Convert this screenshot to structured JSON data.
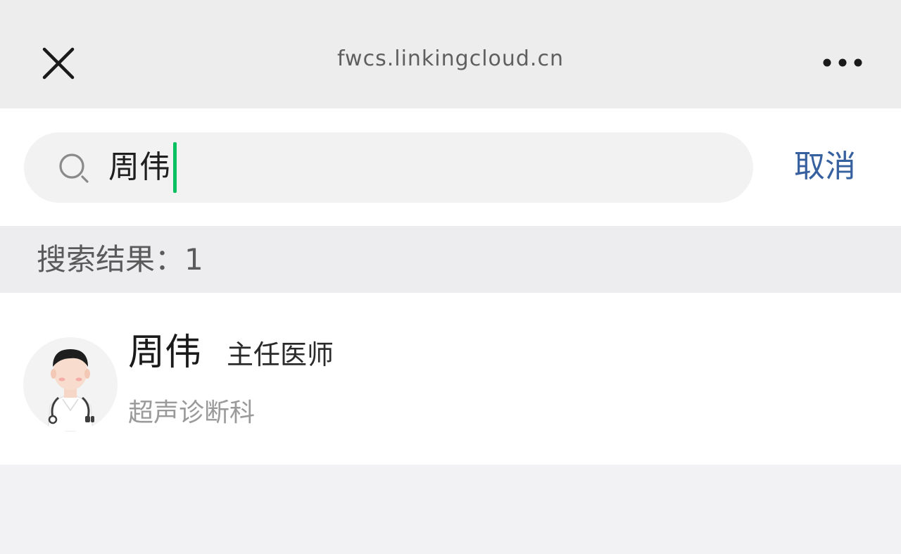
{
  "topbar": {
    "url": "fwcs.linkingcloud.cn",
    "close_icon": "close-icon",
    "more_icon": "more-icon"
  },
  "search": {
    "icon": "search-icon",
    "value": "周伟",
    "cancel_label": "取消",
    "caret_color": "#07c160",
    "cancel_color": "#36619e"
  },
  "results": {
    "label": "搜索结果：1",
    "items": [
      {
        "name": "周伟",
        "title": "主任医师",
        "department": "超声诊断科",
        "avatar_icon": "doctor-avatar-icon"
      }
    ]
  }
}
